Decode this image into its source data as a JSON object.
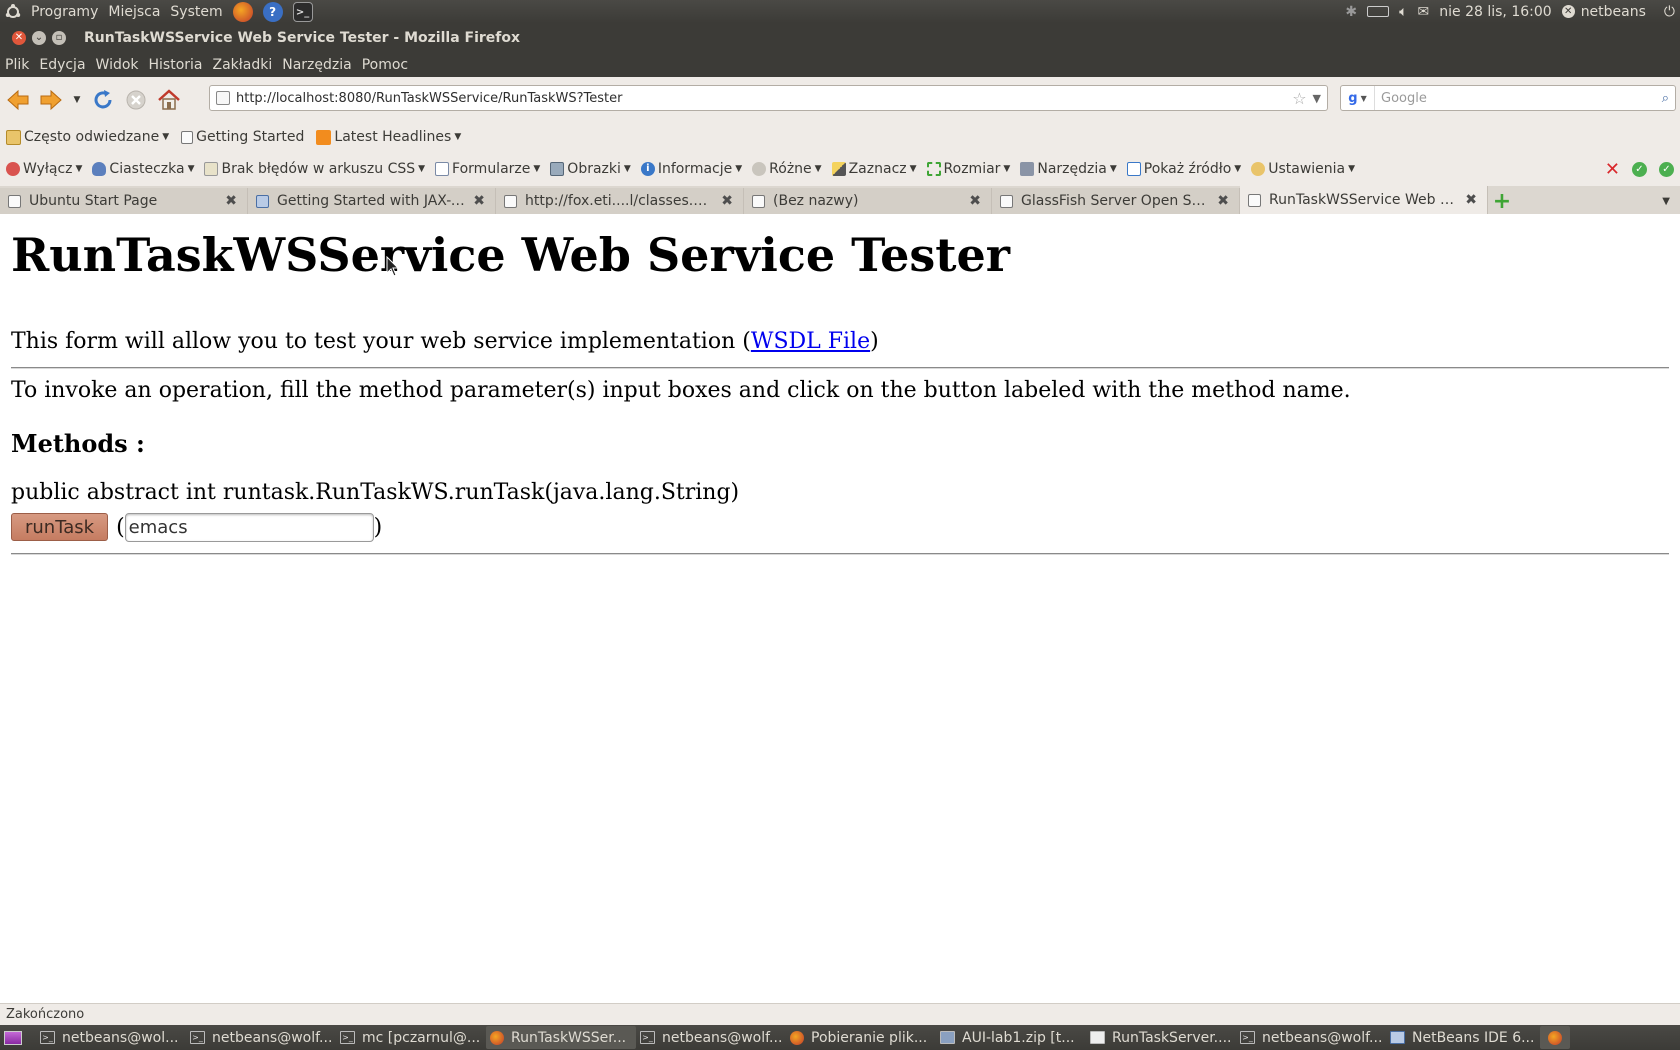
{
  "top_panel": {
    "menus": [
      "Programy",
      "Miejsca",
      "System"
    ],
    "datetime": "nie 28 lis, 16:00",
    "user": "netbeans"
  },
  "window": {
    "title": "RunTaskWSService Web Service Tester - Mozilla Firefox"
  },
  "menubar": {
    "items": [
      "Plik",
      "Edycja",
      "Widok",
      "Historia",
      "Zakładki",
      "Narzędzia",
      "Pomoc"
    ]
  },
  "navigation": {
    "url": "http://localhost:8080/RunTaskWSService/RunTaskWS?Tester",
    "search_placeholder": "Google"
  },
  "bookmarks": {
    "items": [
      "Często odwiedzane",
      "Getting Started",
      "Latest Headlines"
    ]
  },
  "devbar": {
    "items": [
      "Wyłącz",
      "Ciasteczka",
      "Brak błędów w arkuszu CSS",
      "Formularze",
      "Obrazki",
      "Informacje",
      "Różne",
      "Zaznacz",
      "Rozmiar",
      "Narzędzia",
      "Pokaż źródło",
      "Ustawienia"
    ]
  },
  "tabs": [
    {
      "label": "Ubuntu Start Page",
      "active": false
    },
    {
      "label": "Getting Started with JAX-W...",
      "active": false
    },
    {
      "label": "http://fox.eti....l/classes.html",
      "active": false
    },
    {
      "label": "(Bez nazwy)",
      "active": false
    },
    {
      "label": "GlassFish Server Open Sou...",
      "active": false
    },
    {
      "label": "RunTaskWSService Web Se...",
      "active": true
    }
  ],
  "page": {
    "title": "RunTaskWSService Web Service Tester",
    "intro": "This form will allow you to test your web service implementation (",
    "wsdl_link": "WSDL File",
    "intro_end": ")",
    "instructions": "To invoke an operation, fill the method parameter(s) input boxes and click on the button labeled with the method name.",
    "methods_heading": "Methods :",
    "method_signature": "public abstract int runtask.RunTaskWS.runTask(java.lang.String)",
    "method_button": "runTask",
    "param_value": "emacs",
    "open_paren": "(",
    "close_paren": ")"
  },
  "status": {
    "text": "Zakończono"
  },
  "taskbar": [
    {
      "label": "netbeans@wol...",
      "active": false
    },
    {
      "label": "netbeans@wolf...",
      "active": false
    },
    {
      "label": "mc [pczarnul@...",
      "active": false
    },
    {
      "label": "RunTaskWSSer...",
      "active": true
    },
    {
      "label": "netbeans@wolf...",
      "active": false
    },
    {
      "label": "Pobieranie plik...",
      "active": false
    },
    {
      "label": "AUI-lab1.zip [t...",
      "active": false
    },
    {
      "label": "RunTaskServer....",
      "active": false
    },
    {
      "label": "netbeans@wolf...",
      "active": false
    },
    {
      "label": "NetBeans IDE 6...",
      "active": false
    }
  ]
}
